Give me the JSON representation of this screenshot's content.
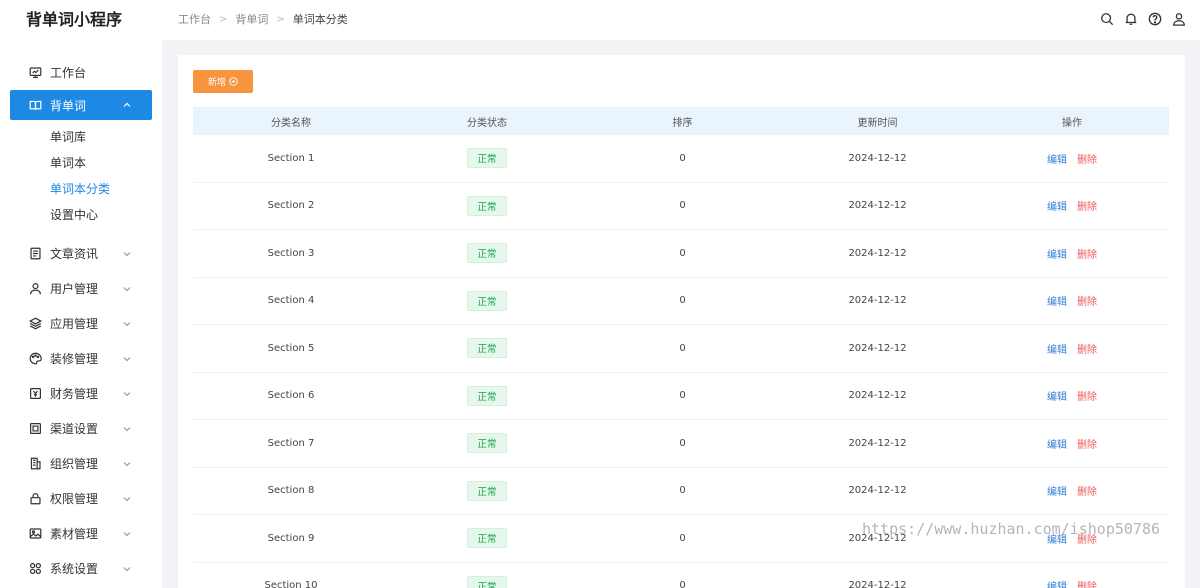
{
  "app": {
    "title": "背单词小程序"
  },
  "colors": {
    "primary": "#1e88e5",
    "accent_button": "#f7953f",
    "status_green": "#16a34a",
    "delete_red": "#ee5a5a",
    "edit_blue": "#2f7fd6"
  },
  "sidebar": {
    "items": [
      {
        "label": "工作台",
        "icon": "monitor-icon"
      },
      {
        "label": "背单词",
        "icon": "book-icon",
        "active": true,
        "expanded": true
      },
      {
        "label": "文章资讯",
        "icon": "document-icon"
      },
      {
        "label": "用户管理",
        "icon": "user-icon"
      },
      {
        "label": "应用管理",
        "icon": "layers-icon"
      },
      {
        "label": "装修管理",
        "icon": "palette-icon"
      },
      {
        "label": "财务管理",
        "icon": "finance-icon"
      },
      {
        "label": "渠道设置",
        "icon": "channel-icon"
      },
      {
        "label": "组织管理",
        "icon": "building-icon"
      },
      {
        "label": "权限管理",
        "icon": "lock-icon"
      },
      {
        "label": "素材管理",
        "icon": "image-icon"
      },
      {
        "label": "系统设置",
        "icon": "grid-icon"
      }
    ],
    "sub_items": [
      {
        "label": "单词库"
      },
      {
        "label": "单词本"
      },
      {
        "label": "单词本分类",
        "current": true
      },
      {
        "label": "设置中心"
      }
    ]
  },
  "header": {
    "breadcrumb": [
      "工作台",
      "背单词",
      "单词本分类"
    ],
    "icons": [
      "search-icon",
      "bell-icon",
      "help-icon",
      "user-icon"
    ]
  },
  "toolbar": {
    "add_label": "新增"
  },
  "table": {
    "columns": [
      "分类名称",
      "分类状态",
      "排序",
      "更新时间",
      "操作"
    ],
    "actions": {
      "edit": "编辑",
      "delete": "删除"
    },
    "rows": [
      {
        "name": "Section 1",
        "status": "正常",
        "sort": "0",
        "updated": "2024-12-12"
      },
      {
        "name": "Section 2",
        "status": "正常",
        "sort": "0",
        "updated": "2024-12-12"
      },
      {
        "name": "Section 3",
        "status": "正常",
        "sort": "0",
        "updated": "2024-12-12"
      },
      {
        "name": "Section 4",
        "status": "正常",
        "sort": "0",
        "updated": "2024-12-12"
      },
      {
        "name": "Section 5",
        "status": "正常",
        "sort": "0",
        "updated": "2024-12-12"
      },
      {
        "name": "Section 6",
        "status": "正常",
        "sort": "0",
        "updated": "2024-12-12"
      },
      {
        "name": "Section 7",
        "status": "正常",
        "sort": "0",
        "updated": "2024-12-12"
      },
      {
        "name": "Section 8",
        "status": "正常",
        "sort": "0",
        "updated": "2024-12-12"
      },
      {
        "name": "Section 9",
        "status": "正常",
        "sort": "0",
        "updated": "2024-12-12"
      },
      {
        "name": "Section 10",
        "status": "正常",
        "sort": "0",
        "updated": "2024-12-12"
      }
    ]
  },
  "watermark": "https://www.huzhan.com/ishop50786"
}
